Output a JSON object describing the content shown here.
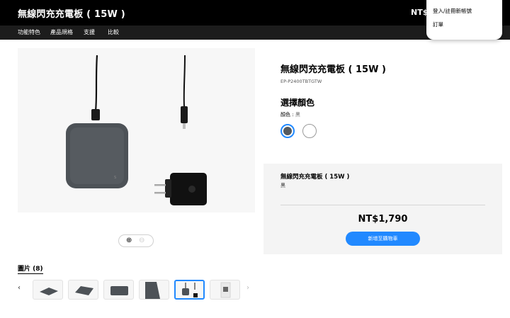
{
  "header": {
    "title": "無線閃充充電板 ( 15W )",
    "price_partial": "NT$1,"
  },
  "subnav": {
    "items": [
      "功能特色",
      "產品規格",
      "支援",
      "比較"
    ]
  },
  "account_menu": {
    "items": [
      "登入/註冊新帳號",
      "訂單"
    ]
  },
  "gallery": {
    "title": "圖片 (8)",
    "prev_icon": "chevron-left-icon",
    "next_icon": "chevron-right-icon",
    "zoom_in_icon": "zoom-in-icon",
    "zoom_out_icon": "zoom-out-icon",
    "thumbnail_count_visible": 6,
    "active_thumbnail_index": 4
  },
  "product": {
    "title": "無線閃充充電板 ( 15W )",
    "sku": "EP-P2400TBTGTW",
    "color_heading": "選擇顏色",
    "color_label": "顏色 :",
    "color_value": "黑",
    "swatches": [
      {
        "name": "黑",
        "hex": "#555a5f",
        "selected": true
      },
      {
        "name": "白",
        "hex": "#ffffff",
        "selected": false
      }
    ]
  },
  "summary": {
    "name": "無線閃充充電板 ( 15W )",
    "color": "黑",
    "price": "NT$1,790",
    "cart_button": "新增至購物車"
  },
  "colors": {
    "accent": "#2189ff",
    "topbar": "#000000",
    "subnav": "#1c1c1c",
    "summary_bg": "#f4f4f4"
  }
}
